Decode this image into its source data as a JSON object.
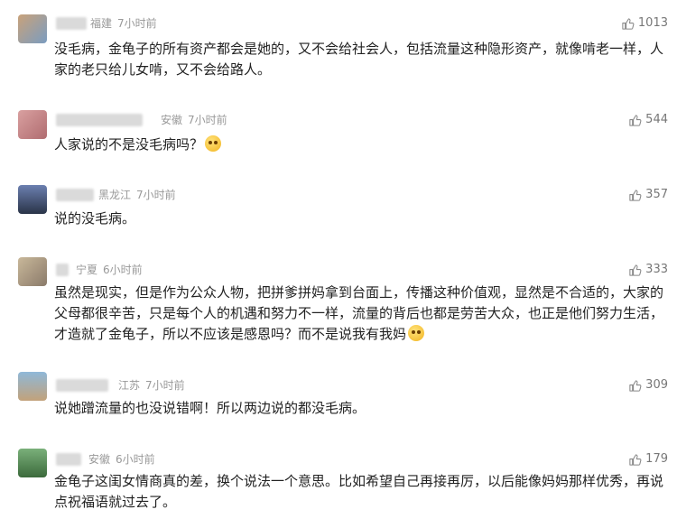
{
  "comments": [
    {
      "location": "福建",
      "time": "7小时前",
      "likes": "1013",
      "text": "没毛病，金龟子的所有资产都会是她的，又不会给社会人，包括流量这种隐形资产，就像啃老一样，人家的老只给儿女啃，又不会给路人。",
      "emoji": false,
      "colors": [
        "#c9a27a",
        "#7a9cc0"
      ]
    },
    {
      "location": "安徽",
      "time": "7小时前",
      "likes": "544",
      "text": "人家说的不是没毛病吗？",
      "emoji": true,
      "colors": [
        "#d9a0a0",
        "#b06c70"
      ]
    },
    {
      "location": "黑龙江",
      "time": "7小时前",
      "likes": "357",
      "text": "说的没毛病。",
      "emoji": false,
      "colors": [
        "#6b7fb0",
        "#2a3448"
      ]
    },
    {
      "location": "宁夏",
      "time": "6小时前",
      "likes": "333",
      "text": "虽然是现实，但是作为公众人物，把拼爹拼妈拿到台面上，传播这种价值观，显然是不合适的，大家的父母都很辛苦，只是每个人的机遇和努力不一样，流量的背后也都是劳苦大众，也正是他们努力生活，才造就了金龟子，所以不应该是感恩吗？而不是说我有我妈",
      "emoji": true,
      "colors": [
        "#c9b89a",
        "#8a7a6a"
      ]
    },
    {
      "location": "江苏",
      "time": "7小时前",
      "likes": "309",
      "text": "说她蹭流量的也没说错啊！所以两边说的都没毛病。",
      "emoji": false,
      "colors": [
        "#8fb8d8",
        "#c2a27a"
      ]
    },
    {
      "location": "安徽",
      "time": "6小时前",
      "likes": "179",
      "text": "金龟子这闺女情商真的差，换个说法一个意思。比如希望自己再接再厉，以后能像妈妈那样优秀，再说点祝福语就过去了。",
      "emoji": false,
      "colors": [
        "#7ab07a",
        "#3c6a3c"
      ]
    }
  ]
}
